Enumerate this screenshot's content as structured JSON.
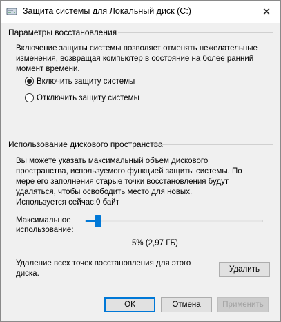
{
  "window": {
    "title": "Защита системы для Локальный диск (C:)",
    "close_glyph": "✕"
  },
  "restore": {
    "group_title": "Параметры восстановления",
    "description": "Включение защиты системы позволяет отменять нежелательные изменения, возвращая компьютер в состояние на более ранний момент времени.",
    "options": [
      {
        "label": "Включить защиту системы",
        "selected": true
      },
      {
        "label": "Отключить защиту системы",
        "selected": false
      }
    ]
  },
  "disk": {
    "group_title": "Использование дискового пространства",
    "description": "Вы можете указать максимальный объем дискового пространства, используемого функцией защиты системы. По мере его заполнения старые точки восстановления будут удаляться, чтобы освободить место для новых.",
    "current_usage_label": "Используется сейчас:",
    "current_usage_value": "0 байт",
    "max_usage_label_line1": "Максимальное",
    "max_usage_label_line2": "использование:",
    "slider_percent": 5,
    "slider_value_text": "5% (2,97 ГБ)",
    "delete_text_line1": "Удаление всех точек восстановления для этого",
    "delete_text_line2": "диска.",
    "delete_button": "Удалить"
  },
  "footer": {
    "ok_button": "ОК",
    "cancel_button": "Отмена",
    "apply_button": "Применить"
  },
  "colors": {
    "accent": "#0078d7"
  }
}
